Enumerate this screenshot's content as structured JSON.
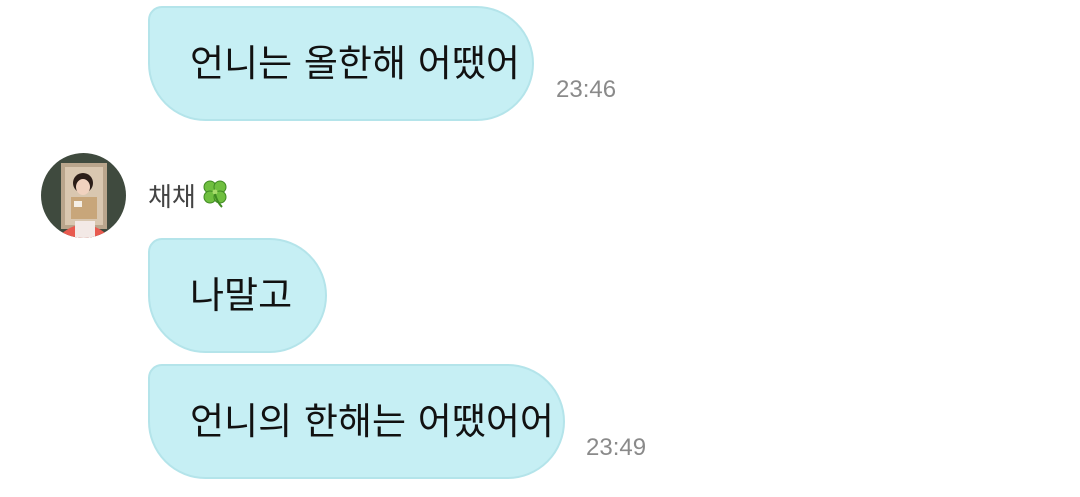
{
  "messages": [
    {
      "text": "언니는 올한해 어땠어",
      "time": "23:46"
    },
    {
      "text": "나말고"
    },
    {
      "text": "언니의 한해는 어땠어어",
      "time": "23:49"
    }
  ],
  "sender": {
    "name": "채채",
    "emoji_icon": "four-leaf-clover-icon"
  },
  "colors": {
    "bubble": "#c6eff4",
    "bubble_border": "#b4e4ea",
    "time": "#8a8a8a"
  }
}
